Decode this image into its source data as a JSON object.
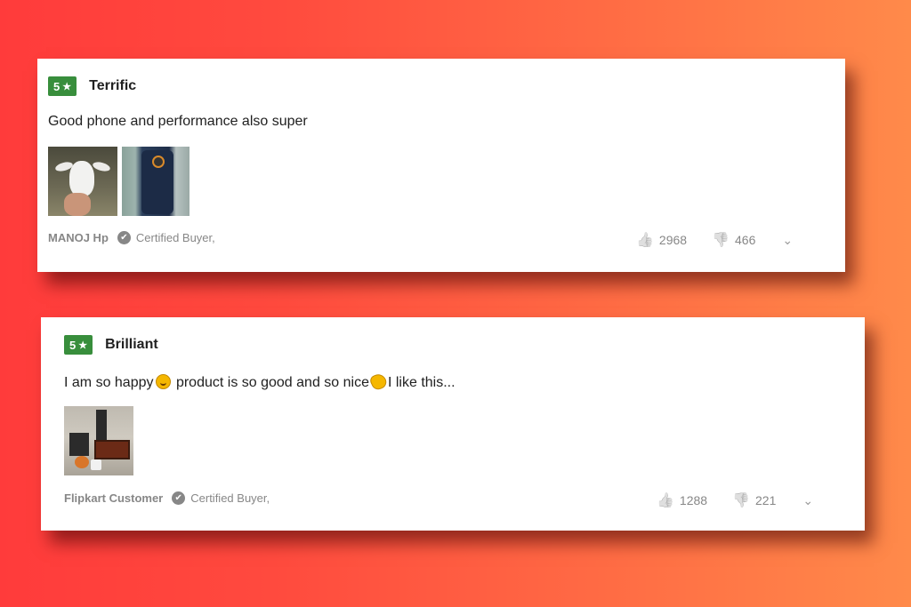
{
  "reviews": [
    {
      "rating": "5",
      "title": "Terrific",
      "text": "Good phone and performance also super",
      "author": "MANOJ Hp",
      "certified": "Certified Buyer,",
      "upvotes": "2968",
      "downvotes": "466",
      "images": [
        "goat-photo",
        "phone-photo"
      ]
    },
    {
      "rating": "5",
      "title": "Brilliant",
      "text_part1": "I am so happy",
      "text_part2": " product is so good and so nice",
      "text_part3": "I like this...",
      "author": "Flipkart Customer",
      "certified": "Certified Buyer,",
      "upvotes": "1288",
      "downvotes": "221",
      "images": [
        "speaker-box-photo"
      ]
    }
  ],
  "icons": {
    "star": "★",
    "check": "✔",
    "thumb_up": "👍",
    "thumb_down": "👎",
    "chevron": "⌄"
  },
  "colors": {
    "rating_badge": "#388e3c",
    "muted_text": "#878787"
  }
}
